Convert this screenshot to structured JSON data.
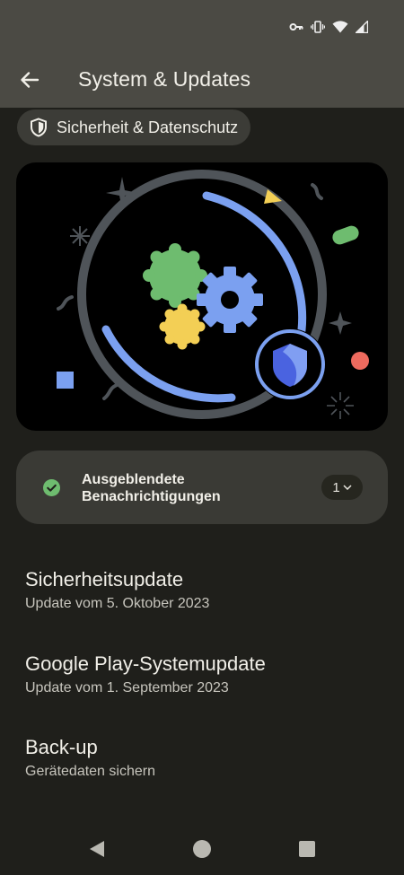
{
  "status_bar": {
    "icons": [
      "key-icon",
      "vibrate-icon",
      "wifi-icon",
      "signal-icon"
    ]
  },
  "app_bar": {
    "title": "System & Updates",
    "back_icon": "arrow-back-icon"
  },
  "chip": {
    "label": "Sicherheit & Datenschutz",
    "icon": "shield-icon"
  },
  "hero": {
    "illustration": "security-illustration",
    "colors": {
      "ring": "#4f5459",
      "arc": "#7ba0f0",
      "gear_green": "#6ebc6f",
      "gear_blue": "#7ba0f0",
      "gear_yellow": "#f3cf55",
      "shield": "#4a63e0",
      "accent_red": "#ee6a5e",
      "accent_yellow": "#f3cf55"
    }
  },
  "notification_card": {
    "label": "Ausgeblendete Benachrichtigungen",
    "label_line1": "Ausgeblendete",
    "label_line2": "Benachrichtigungen",
    "count": "1",
    "check_color": "#6ebc6f"
  },
  "items": [
    {
      "title": "Sicherheitsupdate",
      "subtitle": "Update vom 5. Oktober 2023"
    },
    {
      "title": "Google Play-Systemupdate",
      "subtitle": "Update vom 1. September 2023"
    },
    {
      "title": "Back-up",
      "subtitle": "Gerätedaten sichern"
    }
  ],
  "nav_bar": {
    "buttons": [
      "back-triangle-icon",
      "home-circle-icon",
      "recents-square-icon"
    ]
  }
}
